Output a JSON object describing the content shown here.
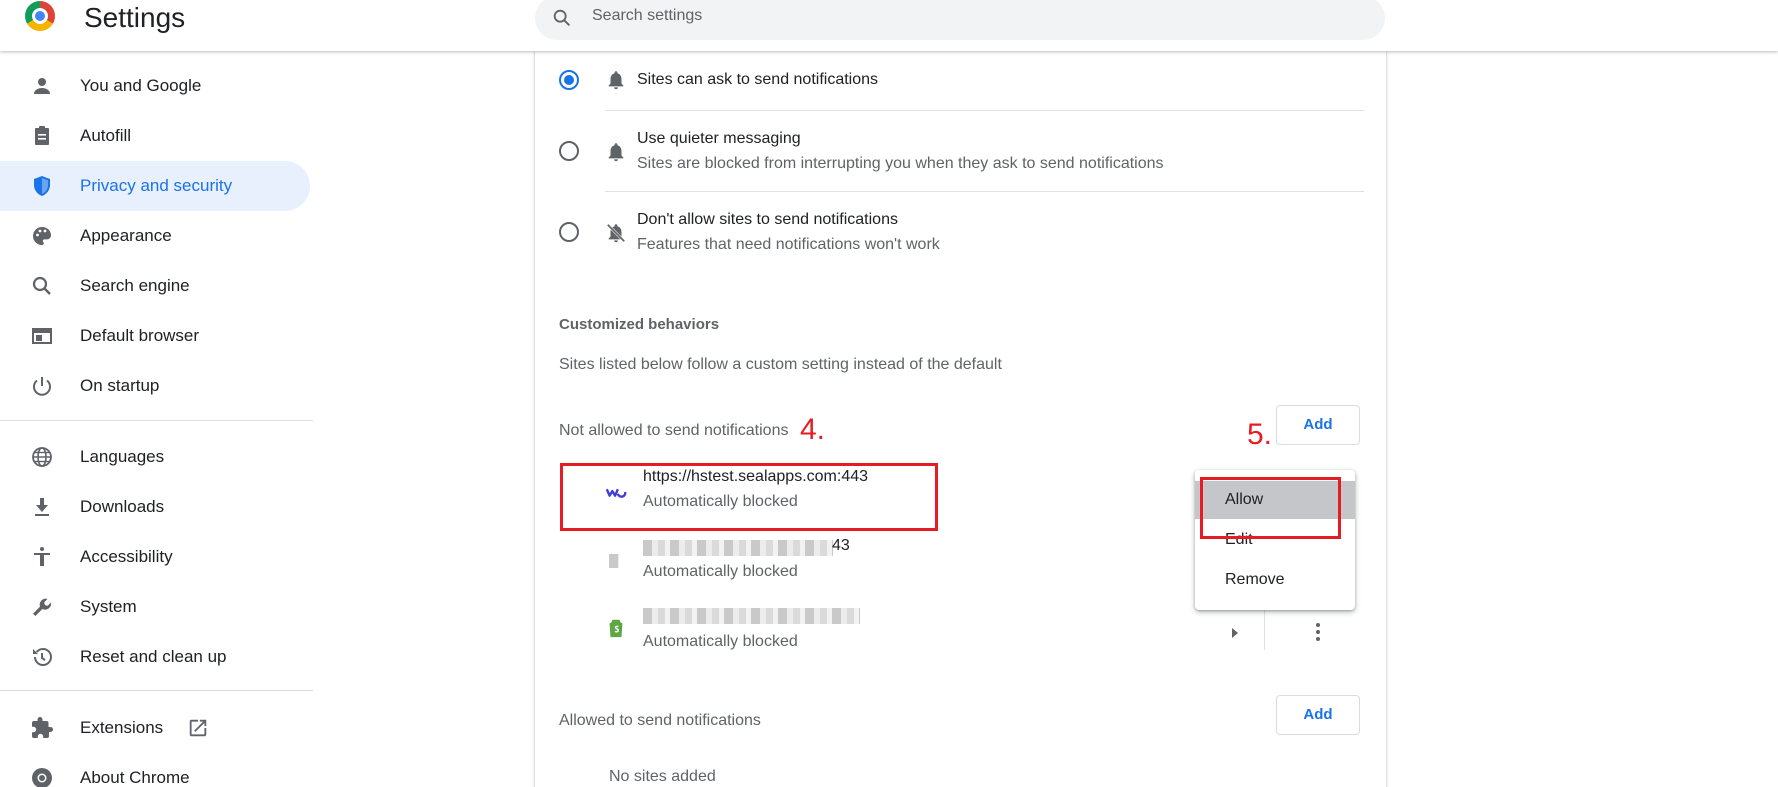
{
  "header": {
    "title": "Settings",
    "search_placeholder": "Search settings"
  },
  "sidebar": {
    "items": [
      {
        "label": "You and Google",
        "icon": "person-icon"
      },
      {
        "label": "Autofill",
        "icon": "clipboard-icon"
      },
      {
        "label": "Privacy and security",
        "icon": "shield-icon",
        "active": true
      },
      {
        "label": "Appearance",
        "icon": "palette-icon"
      },
      {
        "label": "Search engine",
        "icon": "search-icon"
      },
      {
        "label": "Default browser",
        "icon": "browser-window-icon"
      },
      {
        "label": "On startup",
        "icon": "power-icon"
      },
      {
        "label": "Languages",
        "icon": "globe-icon"
      },
      {
        "label": "Downloads",
        "icon": "download-icon"
      },
      {
        "label": "Accessibility",
        "icon": "accessibility-icon"
      },
      {
        "label": "System",
        "icon": "wrench-icon"
      },
      {
        "label": "Reset and clean up",
        "icon": "reset-history-icon"
      },
      {
        "label": "Extensions",
        "icon": "puzzle-icon"
      },
      {
        "label": "About Chrome",
        "icon": "chrome-icon"
      }
    ]
  },
  "notifications": {
    "options": [
      {
        "label": "Sites can ask to send notifications",
        "desc": "",
        "selected": true
      },
      {
        "label": "Use quieter messaging",
        "desc": "Sites are blocked from interrupting you when they ask to send notifications",
        "selected": false
      },
      {
        "label": "Don't allow sites to send notifications",
        "desc": "Features that need notifications won't work",
        "selected": false
      }
    ],
    "customized_title": "Customized behaviors",
    "customized_desc": "Sites listed below follow a custom setting instead of the default",
    "blocked_label": "Not allowed to send notifications",
    "allowed_label": "Allowed to send notifications",
    "add_label": "Add",
    "blocked_sites": [
      {
        "url": "https://hstest.sealapps.com:443",
        "status": "Automatically blocked"
      },
      {
        "url": "43",
        "status": "Automatically blocked"
      },
      {
        "url": "",
        "status": "Automatically blocked"
      }
    ],
    "no_sites": "No sites added"
  },
  "context_menu": {
    "items": [
      "Allow",
      "Edit",
      "Remove"
    ],
    "highlighted": "Allow"
  },
  "annotations": {
    "step4": "4.",
    "step5": "5."
  },
  "colors": {
    "accent": "#1a73e8",
    "annotation": "#e51c23",
    "active_nav_bg": "#e8f0fe"
  }
}
